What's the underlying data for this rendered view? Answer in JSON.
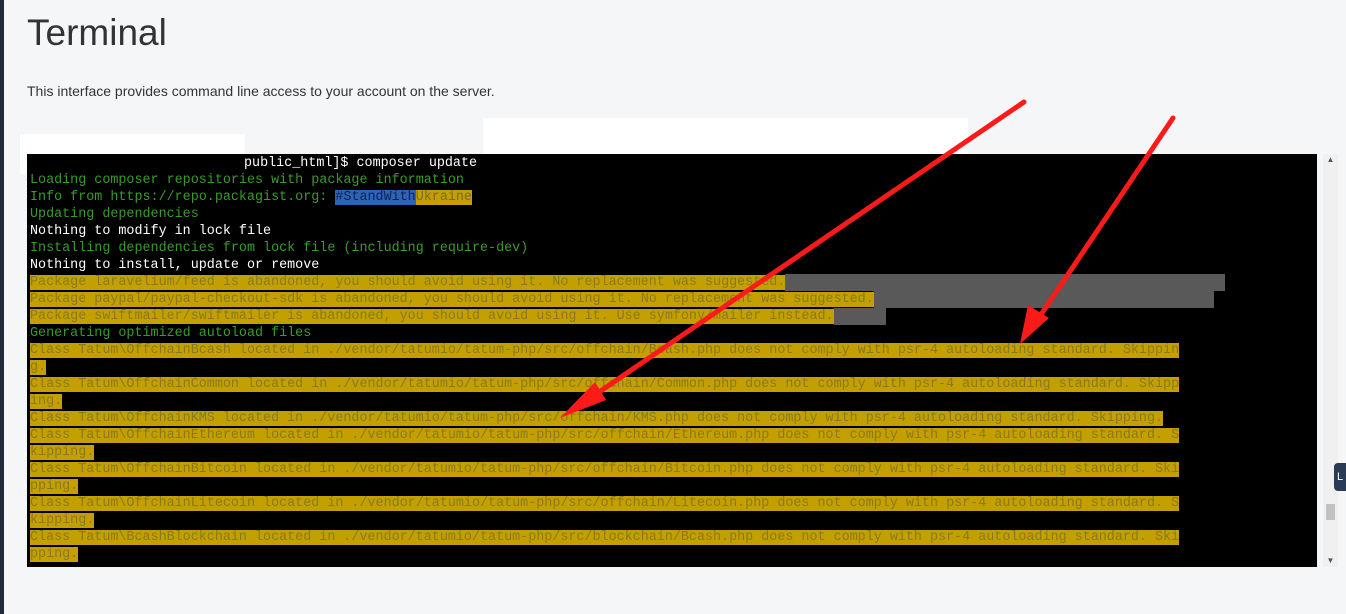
{
  "page": {
    "title": "Terminal",
    "description": "This interface provides command line access to your account on the server."
  },
  "terminal": {
    "prompt_suffix": "public_html]$ composer update",
    "lines": [
      {
        "style": "green",
        "text": "Loading composer repositories with package information"
      },
      {
        "style": "green-info",
        "prefix": "Info from https://repo.packagist.org: ",
        "blue": "#StandWith",
        "yellow": "Ukraine"
      },
      {
        "style": "green",
        "text": "Updating dependencies"
      },
      {
        "style": "white",
        "text": "Nothing to modify in lock file"
      },
      {
        "style": "green",
        "text": "Installing dependencies from lock file (including require-dev)"
      },
      {
        "style": "white",
        "text": "Nothing to install, update or remove"
      },
      {
        "style": "warn",
        "text": "Package laravelium/feed is abandoned, you should avoid using it. No replacement was suggested.",
        "bar": 440
      },
      {
        "style": "warn",
        "text": "Package paypal/paypal-checkout-sdk is abandoned, you should avoid using it. No replacement was suggested.",
        "bar": 340
      },
      {
        "style": "warn",
        "text": "Package swiftmailer/swiftmailer is abandoned, you should avoid using it. Use symfony/mailer instead.",
        "bar": 52
      },
      {
        "style": "green",
        "text": "Generating optimized autoload files"
      },
      {
        "style": "hl",
        "text": "Class Tatum\\OffchainBcash located in ./vendor/tatumio/tatum-php/src/offchain/Bcash.php does not comply with psr-4 autoloading standard. Skippin"
      },
      {
        "style": "hl",
        "text": "g."
      },
      {
        "style": "hl",
        "text": "Class Tatum\\OffchainCommon located in ./vendor/tatumio/tatum-php/src/offchain/Common.php does not comply with psr-4 autoloading standard. Skipp"
      },
      {
        "style": "hl",
        "text": "ing."
      },
      {
        "style": "hl",
        "text": "Class Tatum\\OffchainKMS located in ./vendor/tatumio/tatum-php/src/offchain/KMS.php does not comply with psr-4 autoloading standard. Skipping."
      },
      {
        "style": "hl",
        "text": "Class Tatum\\OffchainEthereum located in ./vendor/tatumio/tatum-php/src/offchain/Ethereum.php does not comply with psr-4 autoloading standard. S"
      },
      {
        "style": "hl",
        "text": "kipping."
      },
      {
        "style": "hl",
        "text": "Class Tatum\\OffchainBitcoin located in ./vendor/tatumio/tatum-php/src/offchain/Bitcoin.php does not comply with psr-4 autoloading standard. Ski"
      },
      {
        "style": "hl",
        "text": "pping."
      },
      {
        "style": "hl",
        "text": "Class Tatum\\OffchainLitecoin located in ./vendor/tatumio/tatum-php/src/offchain/Litecoin.php does not comply with psr-4 autoloading standard. S"
      },
      {
        "style": "hl",
        "text": "kipping."
      },
      {
        "style": "hl",
        "text": "Class Tatum\\BcashBlockchain located in ./vendor/tatumio/tatum-php/src/blockchain/Bcash.php does not comply with psr-4 autoloading standard. Ski"
      },
      {
        "style": "hl",
        "text": "pping."
      }
    ]
  },
  "colors": {
    "terminal_bg": "#000000",
    "green_text": "#3a9b2d",
    "highlight_yellow": "#c3a000",
    "annotation_arrow": "#ff1a1a"
  },
  "icons": {
    "scroll_up": "▲",
    "scroll_down": "▼",
    "side_tab": "L"
  }
}
